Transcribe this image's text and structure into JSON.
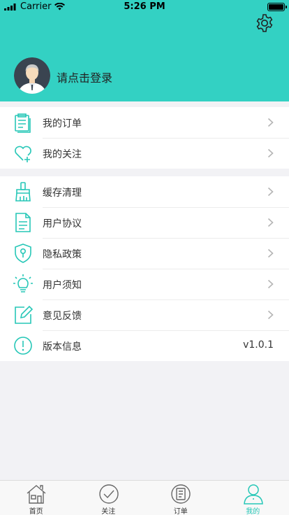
{
  "status_bar": {
    "carrier": "Carrier",
    "time": "5:26 PM"
  },
  "header": {
    "login_prompt": "请点击登录",
    "bg_color": "#33d1c3"
  },
  "menu_group_1": [
    {
      "label": "我的订单",
      "icon": "order-list-icon"
    },
    {
      "label": "我的关注",
      "icon": "heart-plus-icon"
    }
  ],
  "menu_group_2": [
    {
      "label": "缓存清理",
      "icon": "broom-icon"
    },
    {
      "label": "用户协议",
      "icon": "document-icon"
    },
    {
      "label": "隐私政策",
      "icon": "shield-lock-icon"
    },
    {
      "label": "用户须知",
      "icon": "lightbulb-icon"
    },
    {
      "label": "意见反馈",
      "icon": "edit-icon"
    },
    {
      "label": "版本信息",
      "icon": "info-icon",
      "value": "v1.0.1"
    }
  ],
  "tabbar": {
    "tabs": [
      {
        "label": "首页",
        "icon": "home-icon",
        "active": false
      },
      {
        "label": "关注",
        "icon": "check-circle-icon",
        "active": false
      },
      {
        "label": "订单",
        "icon": "order-icon",
        "active": false
      },
      {
        "label": "我的",
        "icon": "person-icon",
        "active": true
      }
    ],
    "active_color": "#26c7b7"
  },
  "accent_color": "#26c7b7"
}
